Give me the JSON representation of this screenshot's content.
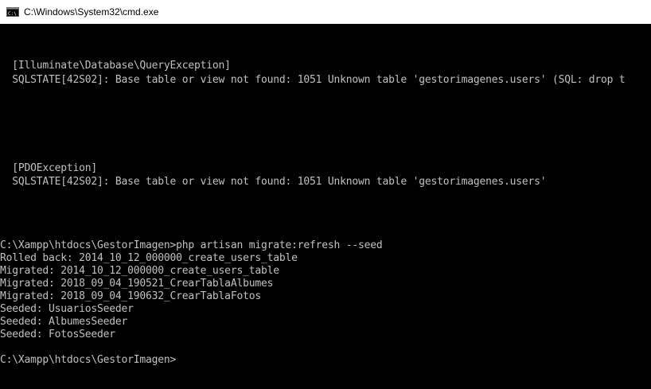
{
  "window": {
    "title": "C:\\Windows\\System32\\cmd.exe",
    "icon": "cmd-icon"
  },
  "console": {
    "text_color": "#c0c0c0",
    "background": "#000000",
    "lines": [
      "  [Illuminate\\Database\\QueryException]",
      "  SQLSTATE[42S02]: Base table or view not found: 1051 Unknown table 'gestorimagenes.users' (SQL: drop t",
      "  [PDOException]",
      "  SQLSTATE[42S02]: Base table or view not found: 1051 Unknown table 'gestorimagenes.users'",
      "C:\\Xampp\\htdocs\\GestorImagen>php artisan migrate:refresh --seed",
      "Rolled back: 2014_10_12_000000_create_users_table",
      "Migrated: 2014_10_12_000000_create_users_table",
      "Migrated: 2018_09_04_190521_CrearTablaAlbumes",
      "Migrated: 2018_09_04_190632_CrearTablaFotos",
      "Seeded: UsuariosSeeder",
      "Seeded: AlbumesSeeder",
      "Seeded: FotosSeeder",
      "C:\\Xampp\\htdocs\\GestorImagen>"
    ]
  }
}
